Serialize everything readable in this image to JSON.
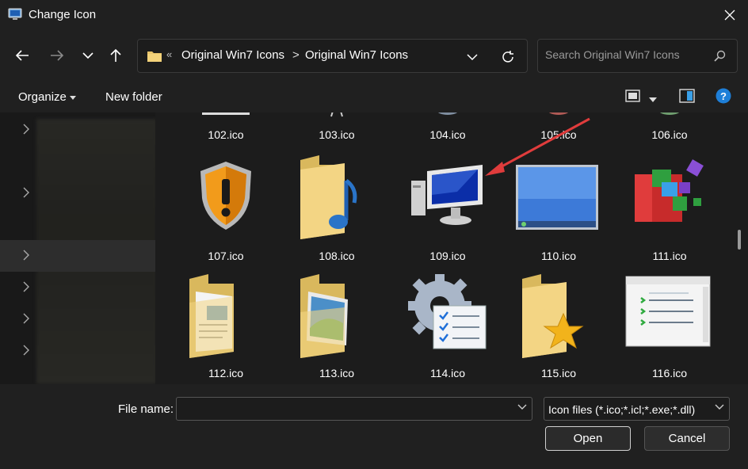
{
  "window": {
    "title": "Change Icon",
    "title_icon": "monitor-icon",
    "close_icon": "close-icon"
  },
  "nav": {
    "back_icon": "back-arrow-icon",
    "forward_icon": "forward-arrow-icon",
    "recent_icon": "chevron-down-icon",
    "up_icon": "up-arrow-icon"
  },
  "address": {
    "overflow": "«",
    "crumbs": [
      "Original Win7 Icons",
      "Original Win7 Icons"
    ],
    "separator": ">"
  },
  "search": {
    "placeholder": "Search Original Win7 Icons"
  },
  "toolbar": {
    "organize": "Organize",
    "new_folder": "New folder"
  },
  "files": [
    {
      "name": "102.ico",
      "icon": "partial-icon"
    },
    {
      "name": "103.ico",
      "icon": "partial-icon"
    },
    {
      "name": "104.ico",
      "icon": "partial-icon"
    },
    {
      "name": "105.ico",
      "icon": "partial-icon"
    },
    {
      "name": "106.ico",
      "icon": "partial-icon"
    },
    {
      "name": "107.ico",
      "icon": "shield-warning-icon"
    },
    {
      "name": "108.ico",
      "icon": "music-folder-icon"
    },
    {
      "name": "109.ico",
      "icon": "computer-monitor-icon"
    },
    {
      "name": "110.ico",
      "icon": "desktop-screen-icon"
    },
    {
      "name": "111.ico",
      "icon": "defrag-blocks-icon"
    },
    {
      "name": "112.ico",
      "icon": "documents-folder-icon"
    },
    {
      "name": "113.ico",
      "icon": "pictures-folder-icon"
    },
    {
      "name": "114.ico",
      "icon": "gear-checklist-icon"
    },
    {
      "name": "115.ico",
      "icon": "favorites-folder-icon"
    },
    {
      "name": "116.ico",
      "icon": "list-window-icon"
    }
  ],
  "bottom": {
    "file_name_label": "File name:",
    "file_name_value": "",
    "filter": "Icon files (*.ico;*.icl;*.exe;*.dll)",
    "open": "Open",
    "cancel": "Cancel"
  },
  "colors": {
    "accent": "#0078d4",
    "arrow": "#e03c3c",
    "folder": "#e8c46a"
  }
}
